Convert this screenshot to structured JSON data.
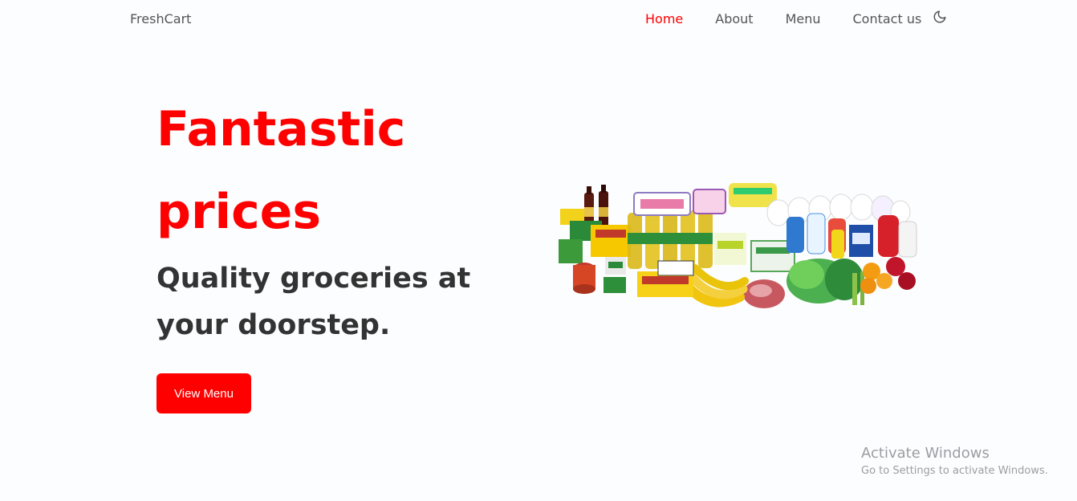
{
  "nav": {
    "brand": "FreshCart",
    "links": [
      {
        "label": "Home",
        "active": true
      },
      {
        "label": "About",
        "active": false
      },
      {
        "label": "Menu",
        "active": false
      },
      {
        "label": "Contact us",
        "active": false
      }
    ],
    "theme_icon": "moon-icon"
  },
  "hero": {
    "title_line1": "Fantastic",
    "title_line2": "prices",
    "subtitle_line1": "Quality groceries at",
    "subtitle_line2": "your doorstep.",
    "cta_label": "View Menu",
    "image": "groceries-assortment-image"
  },
  "watermark": {
    "title": "Activate Windows",
    "subtitle": "Go to Settings to activate Windows."
  },
  "colors": {
    "accent": "#ff0000",
    "text_dark": "#333333",
    "nav_text": "#555555",
    "background": "#fcfdfe"
  }
}
